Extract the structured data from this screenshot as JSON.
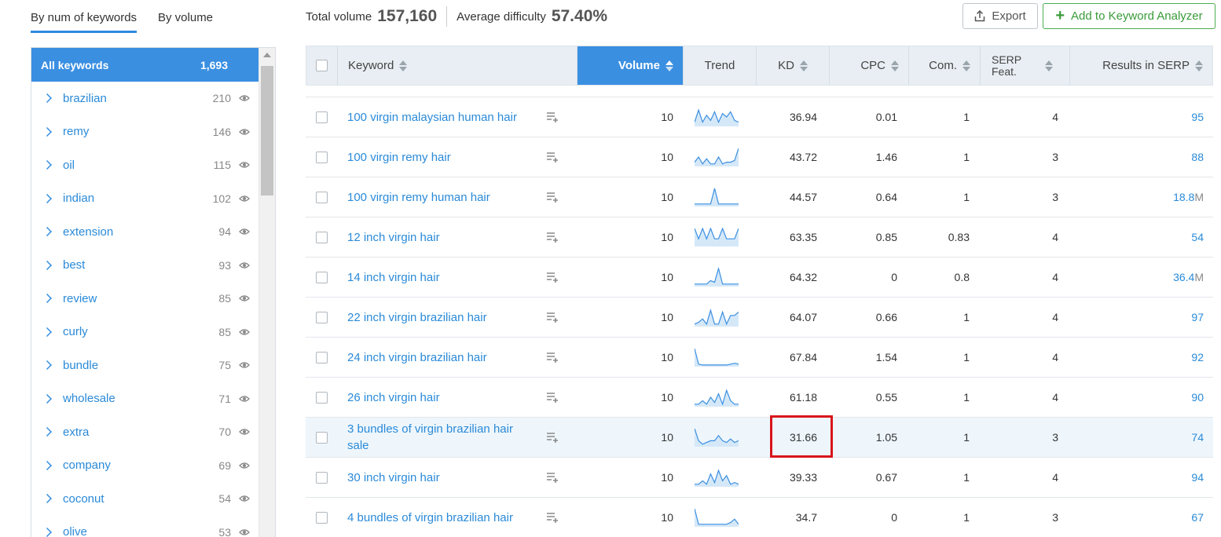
{
  "tabs": [
    "By num of keywords",
    "By volume"
  ],
  "summary": {
    "total_label": "Total volume",
    "total_value": "157,160",
    "difficulty_label": "Average difficulty",
    "difficulty_value": "57.40%"
  },
  "actions": {
    "export": "Export",
    "add": "Add to Keyword Analyzer"
  },
  "sidebar": {
    "header_label": "All keywords",
    "header_count": "1,693",
    "items": [
      {
        "label": "brazilian",
        "count": "210"
      },
      {
        "label": "remy",
        "count": "146"
      },
      {
        "label": "oil",
        "count": "115"
      },
      {
        "label": "indian",
        "count": "102"
      },
      {
        "label": "extension",
        "count": "94"
      },
      {
        "label": "best",
        "count": "93"
      },
      {
        "label": "review",
        "count": "85"
      },
      {
        "label": "curly",
        "count": "85"
      },
      {
        "label": "bundle",
        "count": "75"
      },
      {
        "label": "wholesale",
        "count": "71"
      },
      {
        "label": "extra",
        "count": "70"
      },
      {
        "label": "company",
        "count": "69"
      },
      {
        "label": "coconut",
        "count": "54"
      },
      {
        "label": "olive",
        "count": "53"
      }
    ]
  },
  "table": {
    "columns": {
      "keyword": "Keyword",
      "volume": "Volume",
      "trend": "Trend",
      "kd": "KD",
      "cpc": "CPC",
      "com": "Com.",
      "serp_line1": "SERP",
      "serp_line2": "Feat.",
      "results": "Results in SERP"
    },
    "rows": [
      {
        "keyword": "100 virgin malaysian human hair",
        "volume": "10",
        "kd": "36.94",
        "cpc": "0.01",
        "com": "1",
        "serp": "4",
        "results": "95",
        "results_suffix": "",
        "trend": [
          0.2,
          0.9,
          0.2,
          0.6,
          0.3,
          0.8,
          0.2,
          0.7,
          0.5,
          0.8,
          0.3,
          0.2
        ]
      },
      {
        "keyword": "100 virgin remy hair",
        "volume": "10",
        "kd": "43.72",
        "cpc": "1.46",
        "com": "1",
        "serp": "3",
        "results": "88",
        "results_suffix": "",
        "trend": [
          0.2,
          0.5,
          0.1,
          0.4,
          0.1,
          0.1,
          0.5,
          0.1,
          0.2,
          0.2,
          0.3,
          1.0
        ]
      },
      {
        "keyword": "100 virgin remy human hair",
        "volume": "10",
        "kd": "44.57",
        "cpc": "0.64",
        "com": "1",
        "serp": "3",
        "results": "18.8",
        "results_suffix": "M",
        "trend": [
          0.1,
          0.1,
          0.1,
          0.1,
          0.1,
          1.0,
          0.1,
          0.1,
          0.1,
          0.1,
          0.1,
          0.1
        ]
      },
      {
        "keyword": "12 inch virgin hair",
        "volume": "10",
        "kd": "63.35",
        "cpc": "0.85",
        "com": "0.83",
        "serp": "4",
        "results": "54",
        "results_suffix": "",
        "trend": [
          1.0,
          0.4,
          1.0,
          0.4,
          1.0,
          0.4,
          0.4,
          1.0,
          0.4,
          0.4,
          0.4,
          1.0
        ]
      },
      {
        "keyword": "14 inch virgin hair",
        "volume": "10",
        "kd": "64.32",
        "cpc": "0",
        "com": "0.8",
        "serp": "4",
        "results": "36.4",
        "results_suffix": "M",
        "trend": [
          0.1,
          0.1,
          0.1,
          0.1,
          0.3,
          0.2,
          1.0,
          0.1,
          0.1,
          0.1,
          0.1,
          0.1
        ]
      },
      {
        "keyword": "22 inch virgin brazilian hair",
        "volume": "10",
        "kd": "64.07",
        "cpc": "0.66",
        "com": "1",
        "serp": "4",
        "results": "97",
        "results_suffix": "",
        "trend": [
          0.1,
          0.2,
          0.4,
          0.1,
          0.9,
          0.1,
          0.1,
          0.8,
          0.1,
          0.6,
          0.6,
          0.8
        ]
      },
      {
        "keyword": "24 inch virgin brazilian hair",
        "volume": "10",
        "kd": "67.84",
        "cpc": "1.54",
        "com": "1",
        "serp": "4",
        "results": "92",
        "results_suffix": "",
        "trend": [
          1.0,
          0.1,
          0.05,
          0.05,
          0.05,
          0.05,
          0.05,
          0.05,
          0.05,
          0.1,
          0.15,
          0.1
        ]
      },
      {
        "keyword": "26 inch virgin hair",
        "volume": "10",
        "kd": "61.18",
        "cpc": "0.55",
        "com": "1",
        "serp": "4",
        "results": "90",
        "results_suffix": "",
        "trend": [
          0.1,
          0.1,
          0.3,
          0.1,
          0.5,
          0.2,
          0.7,
          0.1,
          0.9,
          0.3,
          0.1,
          0.1
        ]
      },
      {
        "keyword": "3 bundles of virgin brazilian hair sale",
        "volume": "10",
        "kd": "31.66",
        "cpc": "1.05",
        "com": "1",
        "serp": "3",
        "results": "74",
        "results_suffix": "",
        "trend": [
          1.0,
          0.3,
          0.1,
          0.2,
          0.3,
          0.3,
          0.6,
          0.3,
          0.2,
          0.4,
          0.2,
          0.3
        ]
      },
      {
        "keyword": "30 inch virgin hair",
        "volume": "10",
        "kd": "39.33",
        "cpc": "0.67",
        "com": "1",
        "serp": "4",
        "results": "94",
        "results_suffix": "",
        "trend": [
          0.1,
          0.1,
          0.3,
          0.1,
          0.7,
          0.2,
          0.9,
          0.3,
          0.6,
          0.1,
          0.2,
          0.1
        ]
      },
      {
        "keyword": "4 bundles of virgin brazilian hair",
        "volume": "10",
        "kd": "34.7",
        "cpc": "0",
        "com": "1",
        "serp": "3",
        "results": "67",
        "results_suffix": "",
        "trend": [
          1.0,
          0.1,
          0.1,
          0.1,
          0.1,
          0.1,
          0.1,
          0.1,
          0.1,
          0.2,
          0.4,
          0.1
        ]
      }
    ]
  },
  "highlight": {
    "row_index": 8,
    "column": "kd",
    "box_color": "#d9141b"
  },
  "colors": {
    "accent": "#3a8fe1",
    "link": "#2a8ad8",
    "add_button": "#4caf50"
  }
}
